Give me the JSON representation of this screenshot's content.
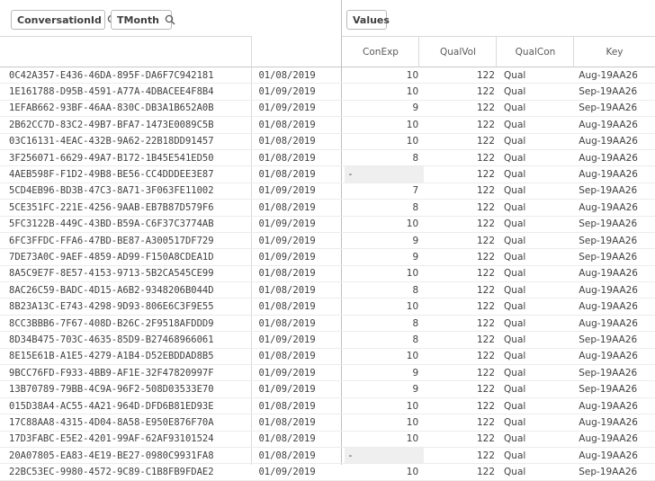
{
  "dimension_chips": [
    {
      "label": "ConversationId"
    },
    {
      "label": "TMonth"
    }
  ],
  "measure_chip": {
    "label": "Values"
  },
  "columns": [
    "ConExp",
    "QualVol",
    "QualCon",
    "Key"
  ],
  "rows": [
    {
      "id": "0C42A357-E436-46DA-895F-DA6F7C942181",
      "month": "01/08/2019",
      "conexp": "10",
      "qualvol": "122",
      "qualcon": "Qual",
      "key": "Aug-19AA26"
    },
    {
      "id": "1E161788-D95B-4591-A77A-4DBACEE4F8B4",
      "month": "01/09/2019",
      "conexp": "10",
      "qualvol": "122",
      "qualcon": "Qual",
      "key": "Sep-19AA26"
    },
    {
      "id": "1EFAB662-93BF-46AA-830C-DB3A1B652A0B",
      "month": "01/09/2019",
      "conexp": "9",
      "qualvol": "122",
      "qualcon": "Qual",
      "key": "Sep-19AA26"
    },
    {
      "id": "2B62CC7D-83C2-49B7-BFA7-1473E0089C5B",
      "month": "01/08/2019",
      "conexp": "10",
      "qualvol": "122",
      "qualcon": "Qual",
      "key": "Aug-19AA26"
    },
    {
      "id": "03C16131-4EAC-432B-9A62-22B18DD91457",
      "month": "01/08/2019",
      "conexp": "10",
      "qualvol": "122",
      "qualcon": "Qual",
      "key": "Aug-19AA26"
    },
    {
      "id": "3F256071-6629-49A7-B172-1B45E541ED50",
      "month": "01/08/2019",
      "conexp": "8",
      "qualvol": "122",
      "qualcon": "Qual",
      "key": "Aug-19AA26"
    },
    {
      "id": "4AEB598F-F1D2-49B8-BE56-CC4DDDEE3E87",
      "month": "01/08/2019",
      "conexp": "-",
      "qualvol": "122",
      "qualcon": "Qual",
      "key": "Aug-19AA26"
    },
    {
      "id": "5CD4EB96-BD3B-47C3-8A71-3F063FE11002",
      "month": "01/09/2019",
      "conexp": "7",
      "qualvol": "122",
      "qualcon": "Qual",
      "key": "Sep-19AA26"
    },
    {
      "id": "5CE351FC-221E-4256-9AAB-EB7B87D579F6",
      "month": "01/08/2019",
      "conexp": "8",
      "qualvol": "122",
      "qualcon": "Qual",
      "key": "Aug-19AA26"
    },
    {
      "id": "5FC3122B-449C-43BD-B59A-C6F37C3774AB",
      "month": "01/09/2019",
      "conexp": "10",
      "qualvol": "122",
      "qualcon": "Qual",
      "key": "Sep-19AA26"
    },
    {
      "id": "6FC3FFDC-FFA6-47BD-BE87-A300517DF729",
      "month": "01/09/2019",
      "conexp": "9",
      "qualvol": "122",
      "qualcon": "Qual",
      "key": "Sep-19AA26"
    },
    {
      "id": "7DE73A0C-9AEF-4859-AD99-F150A8CDEA1D",
      "month": "01/09/2019",
      "conexp": "9",
      "qualvol": "122",
      "qualcon": "Qual",
      "key": "Sep-19AA26"
    },
    {
      "id": "8A5C9E7F-8E57-4153-9713-5B2CA545CE99",
      "month": "01/08/2019",
      "conexp": "10",
      "qualvol": "122",
      "qualcon": "Qual",
      "key": "Aug-19AA26"
    },
    {
      "id": "8AC26C59-BADC-4D15-A6B2-9348206B044D",
      "month": "01/08/2019",
      "conexp": "8",
      "qualvol": "122",
      "qualcon": "Qual",
      "key": "Aug-19AA26"
    },
    {
      "id": "8B23A13C-E743-4298-9D93-806E6C3F9E55",
      "month": "01/08/2019",
      "conexp": "10",
      "qualvol": "122",
      "qualcon": "Qual",
      "key": "Aug-19AA26"
    },
    {
      "id": "8CC3BBB6-7F67-408D-B26C-2F9518AFDDD9",
      "month": "01/08/2019",
      "conexp": "8",
      "qualvol": "122",
      "qualcon": "Qual",
      "key": "Aug-19AA26"
    },
    {
      "id": "8D34B475-703C-4635-85D9-B27468966061",
      "month": "01/09/2019",
      "conexp": "8",
      "qualvol": "122",
      "qualcon": "Qual",
      "key": "Sep-19AA26"
    },
    {
      "id": "8E15E61B-A1E5-4279-A1B4-D52EBDDAD8B5",
      "month": "01/08/2019",
      "conexp": "10",
      "qualvol": "122",
      "qualcon": "Qual",
      "key": "Aug-19AA26"
    },
    {
      "id": "9BCC76FD-F933-4BB9-AF1E-32F47820997F",
      "month": "01/09/2019",
      "conexp": "9",
      "qualvol": "122",
      "qualcon": "Qual",
      "key": "Sep-19AA26"
    },
    {
      "id": "13B70789-79BB-4C9A-96F2-508D03533E70",
      "month": "01/09/2019",
      "conexp": "9",
      "qualvol": "122",
      "qualcon": "Qual",
      "key": "Sep-19AA26"
    },
    {
      "id": "015D38A4-AC55-4A21-964D-DFD6B81ED93E",
      "month": "01/08/2019",
      "conexp": "10",
      "qualvol": "122",
      "qualcon": "Qual",
      "key": "Aug-19AA26"
    },
    {
      "id": "17C88AA8-4315-4D04-8A58-E950E876F70A",
      "month": "01/08/2019",
      "conexp": "10",
      "qualvol": "122",
      "qualcon": "Qual",
      "key": "Aug-19AA26"
    },
    {
      "id": "17D3FABC-E5E2-4201-99AF-62AF93101524",
      "month": "01/08/2019",
      "conexp": "10",
      "qualvol": "122",
      "qualcon": "Qual",
      "key": "Aug-19AA26"
    },
    {
      "id": "20A07805-EA83-4E19-BE27-0980C9931FA8",
      "month": "01/08/2019",
      "conexp": "-",
      "qualvol": "122",
      "qualcon": "Qual",
      "key": "Aug-19AA26"
    },
    {
      "id": "22BC53EC-9980-4572-9C89-C1B8FB9FDAE2",
      "month": "01/09/2019",
      "conexp": "10",
      "qualvol": "122",
      "qualcon": "Qual",
      "key": "Sep-19AA26"
    }
  ]
}
